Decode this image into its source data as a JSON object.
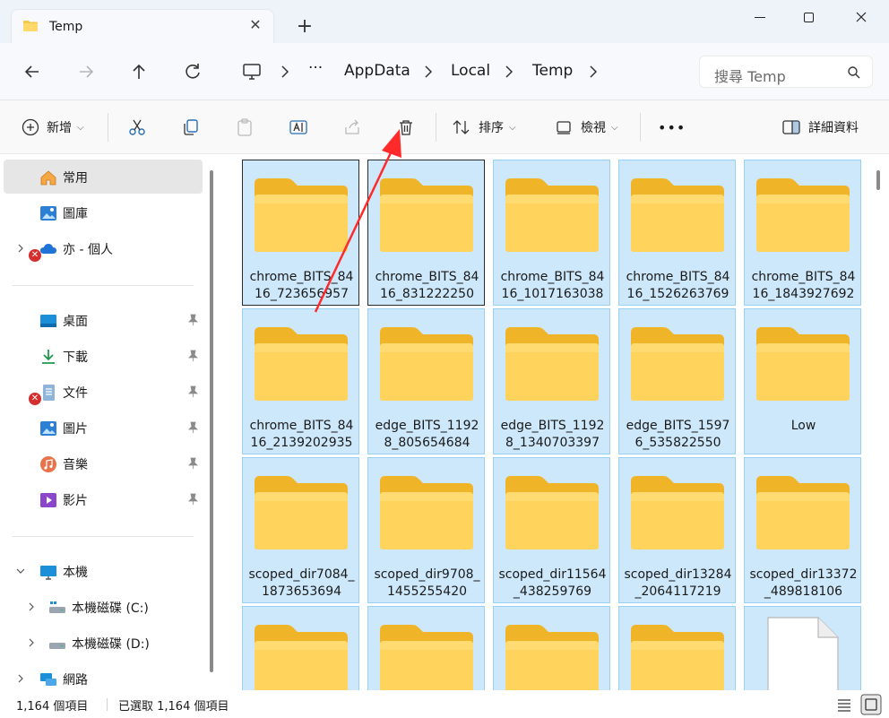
{
  "tab": {
    "title": "Temp",
    "close_glyph": "✕",
    "new_tab_glyph": "+"
  },
  "address": {
    "crumbs": [
      "AppData",
      "Local",
      "Temp"
    ],
    "more_glyph": "···",
    "search_placeholder": "搜尋 Temp"
  },
  "toolbar": {
    "new_label": "新增",
    "sort_label": "排序",
    "view_label": "檢視",
    "more_glyph": "•••",
    "details_label": "詳細資料",
    "dropdown_glyph": "⌵"
  },
  "sidebar": {
    "home": "常用",
    "gallery": "圖庫",
    "onedrive": "亦 - 個人",
    "desktop": "桌面",
    "downloads": "下載",
    "documents": "文件",
    "pictures": "圖片",
    "music": "音樂",
    "videos": "影片",
    "thispc": "本機",
    "drive_c": "本機磁碟 (C:)",
    "drive_d": "本機磁碟 (D:)",
    "network": "網路",
    "error_glyph": "✕"
  },
  "files": [
    "chrome_BITS_8416_723656957",
    "chrome_BITS_8416_831222250",
    "chrome_BITS_8416_1017163038",
    "chrome_BITS_8416_1526263769",
    "chrome_BITS_8416_1843927692",
    "chrome_BITS_8416_2139202935",
    "edge_BITS_11928_805654684",
    "edge_BITS_11928_1340703397",
    "edge_BITS_15976_535822550",
    "Low",
    "scoped_dir7084_1873653694",
    "scoped_dir9708_1455255420",
    "scoped_dir11564_438259769",
    "scoped_dir13284_2064117219",
    "scoped_dir13372_489818106"
  ],
  "status": {
    "item_count": "1,164 個項目",
    "selected": "已選取 1,164 個項目"
  },
  "colors": {
    "selection": "#cde8fb",
    "selection_border": "#99d1f4",
    "annotation_arrow": "#ff2a2a"
  }
}
